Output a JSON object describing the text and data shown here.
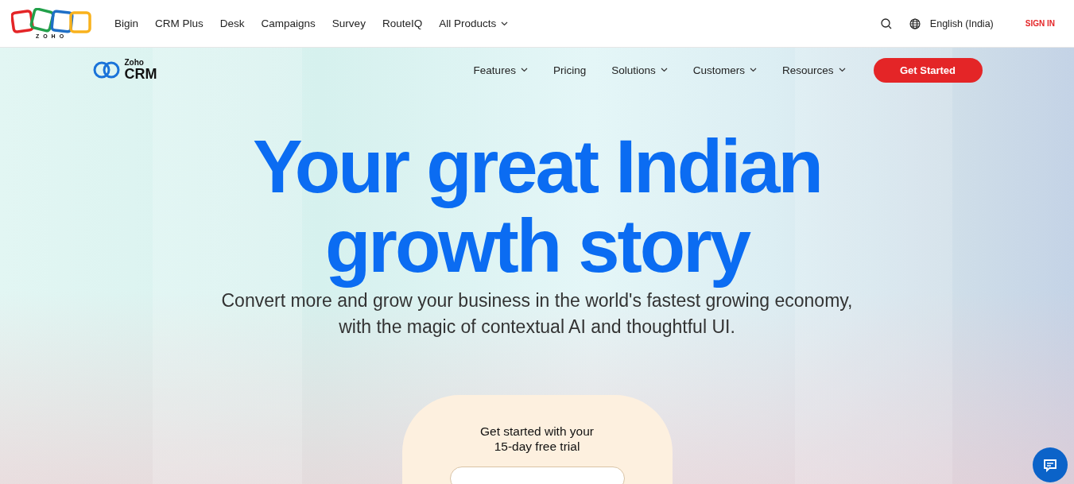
{
  "top_bar": {
    "logo_text": "ZOHO",
    "products": [
      {
        "label": "Bigin",
        "has_menu": false
      },
      {
        "label": "CRM Plus",
        "has_menu": false
      },
      {
        "label": "Desk",
        "has_menu": false
      },
      {
        "label": "Campaigns",
        "has_menu": false
      },
      {
        "label": "Survey",
        "has_menu": false
      },
      {
        "label": "RouteIQ",
        "has_menu": false
      },
      {
        "label": "All Products",
        "has_menu": true
      }
    ],
    "language": "English (India)",
    "sign_in": "SIGN IN"
  },
  "product_nav": {
    "logo_small": "Zoho",
    "logo_big": "CRM",
    "items": [
      {
        "label": "Features",
        "has_menu": true
      },
      {
        "label": "Pricing",
        "has_menu": false
      },
      {
        "label": "Solutions",
        "has_menu": true
      },
      {
        "label": "Customers",
        "has_menu": true
      },
      {
        "label": "Resources",
        "has_menu": true
      }
    ],
    "cta": "Get Started"
  },
  "hero": {
    "title_lines": [
      "Your great Indian",
      "growth story"
    ],
    "subtitle_lines": [
      "Convert more and grow your business in the world's fastest growing economy,",
      "with the magic of contextual AI and thoughtful UI."
    ]
  },
  "signup_card": {
    "title_lines": [
      "Get started with your",
      "15-day free trial"
    ]
  }
}
